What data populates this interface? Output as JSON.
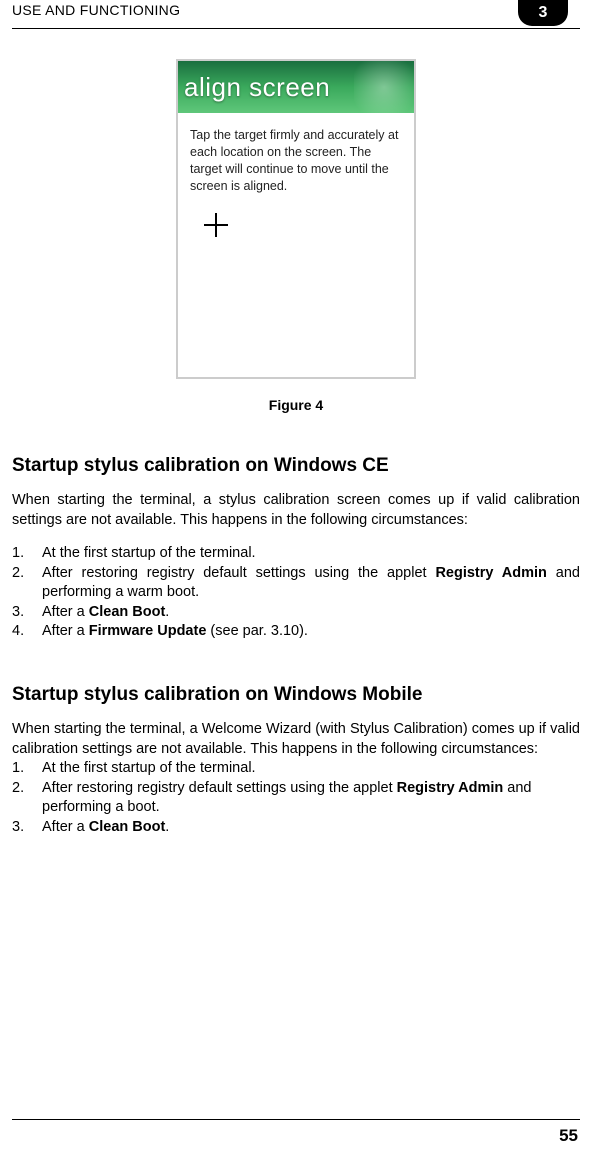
{
  "header": {
    "title": "USE AND FUNCTIONING",
    "chapter_badge": "3"
  },
  "figure": {
    "banner_text": "align screen",
    "instruction": "Tap the target firmly and accurately at each location on the screen. The target will continue to move until the screen is aligned.",
    "caption": "Figure 4"
  },
  "section_ce": {
    "heading": "Startup stylus calibration on Windows CE",
    "intro": "When starting the terminal, a stylus calibration screen comes up if valid calibration settings are not available. This happens in the following circumstances:",
    "items": [
      {
        "num": "1.",
        "text": "At the first startup of the terminal."
      },
      {
        "num": "2.",
        "text_pre": "After restoring registry default settings using the applet ",
        "bold": "Registry Admin",
        "text_post": " and performing a warm boot."
      },
      {
        "num": "3.",
        "text_pre": "After a ",
        "bold": "Clean Boot",
        "text_post": "."
      },
      {
        "num": "4.",
        "text_pre": "After a ",
        "bold": "Firmware Update",
        "text_post": " (see par. 3.10)."
      }
    ]
  },
  "section_mobile": {
    "heading": "Startup stylus calibration on Windows Mobile",
    "intro": "When starting the terminal, a Welcome Wizard (with Stylus Calibration) comes up if valid calibration settings are not available. This happens in the following circumstances:",
    "items": [
      {
        "num": "1.",
        "text": "At the first startup of the terminal."
      },
      {
        "num": "2.",
        "text_pre": "After restoring registry default settings using the applet ",
        "bold": "Registry Admin",
        "text_post": " and",
        "line2": "performing a boot."
      },
      {
        "num": "3.",
        "text_pre": "After a ",
        "bold": "Clean Boot",
        "text_post": "."
      }
    ]
  },
  "footer": {
    "page": "55"
  }
}
